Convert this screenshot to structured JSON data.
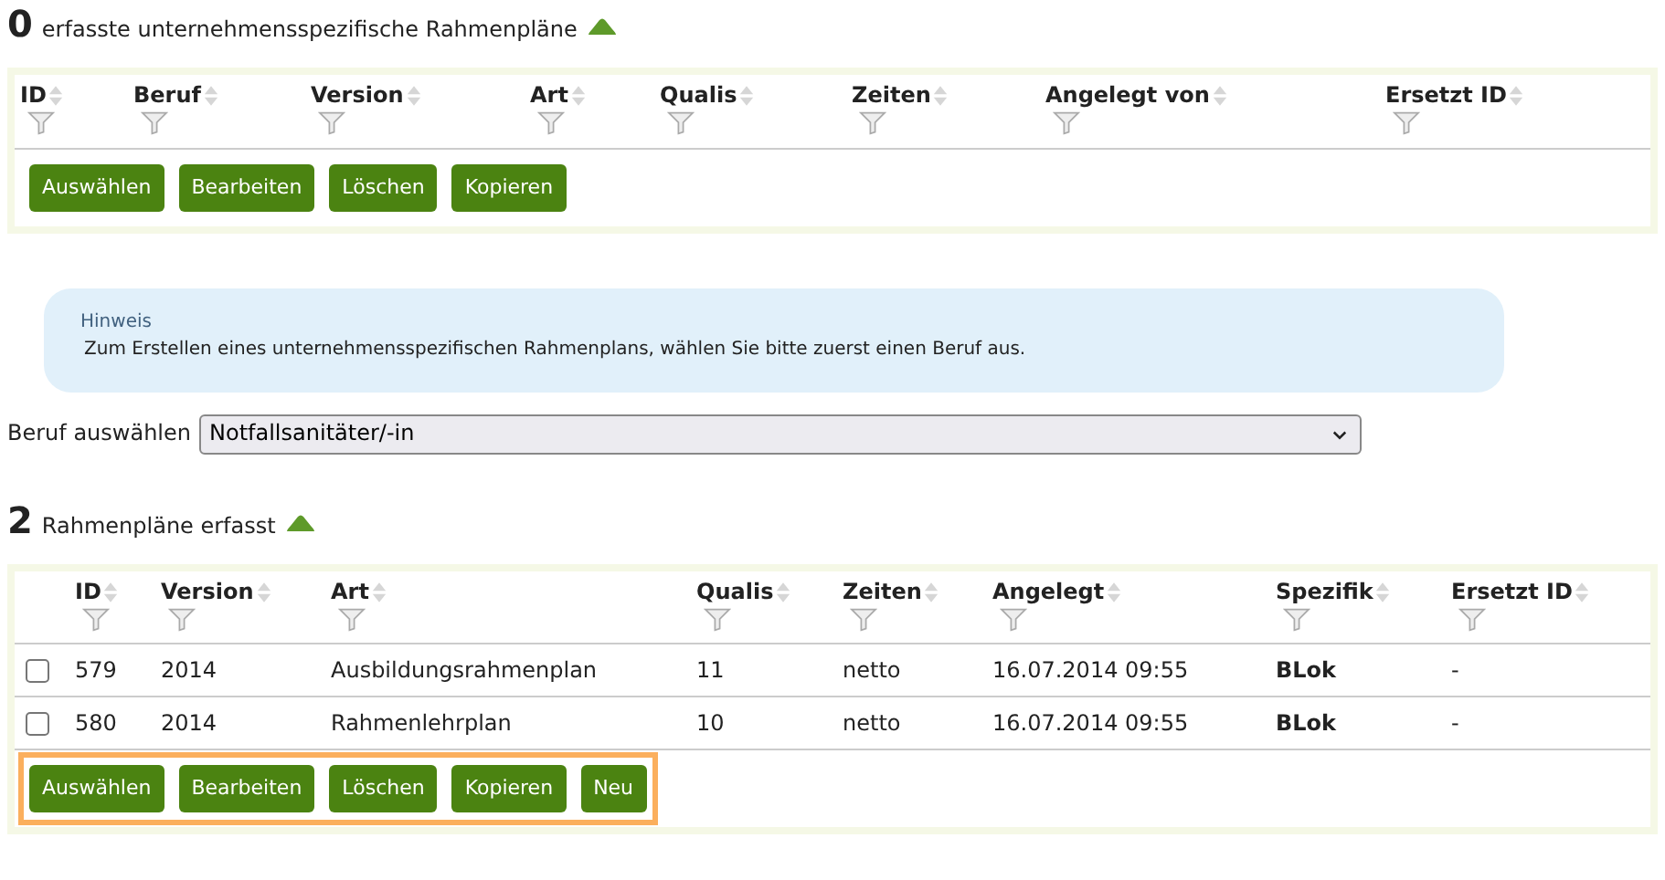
{
  "section_1": {
    "count": "0",
    "title": "erfasste unternehmensspezifische Rahmenpläne",
    "columns": [
      "ID",
      "Beruf",
      "Version",
      "Art",
      "Qualis",
      "Zeiten",
      "Angelegt von",
      "Ersetzt ID"
    ],
    "buttons": [
      {
        "label": "Auswählen"
      },
      {
        "label": "Bearbeiten"
      },
      {
        "label": "Löschen"
      },
      {
        "label": "Kopieren"
      }
    ],
    "buttons_highlighted": false
  },
  "hint": {
    "title": "Hinweis",
    "text": "Zum Erstellen eines unternehmensspezifischen Rahmenplans, wählen Sie bitte zuerst einen Beruf aus."
  },
  "beruf_select": {
    "label": "Beruf auswählen",
    "value": "Notfallsanitäter/-in"
  },
  "section_2": {
    "count": "2",
    "title": "Rahmenpläne erfasst",
    "columns": [
      "ID",
      "Version",
      "Art",
      "Qualis",
      "Zeiten",
      "Angelegt",
      "Spezifik",
      "Ersetzt ID"
    ],
    "rows": [
      {
        "checked": false,
        "cells": [
          "579",
          "2014",
          "Ausbildungsrahmenplan",
          "11",
          "netto",
          "16.07.2014 09:55",
          "BLok",
          "-"
        ]
      },
      {
        "checked": false,
        "cells": [
          "580",
          "2014",
          "Rahmenlehrplan",
          "10",
          "netto",
          "16.07.2014 09:55",
          "BLok",
          "-"
        ]
      }
    ],
    "buttons": [
      {
        "label": "Auswählen"
      },
      {
        "label": "Bearbeiten"
      },
      {
        "label": "Löschen"
      },
      {
        "label": "Kopieren"
      },
      {
        "label": "Neu"
      }
    ],
    "buttons_highlighted": true
  }
}
